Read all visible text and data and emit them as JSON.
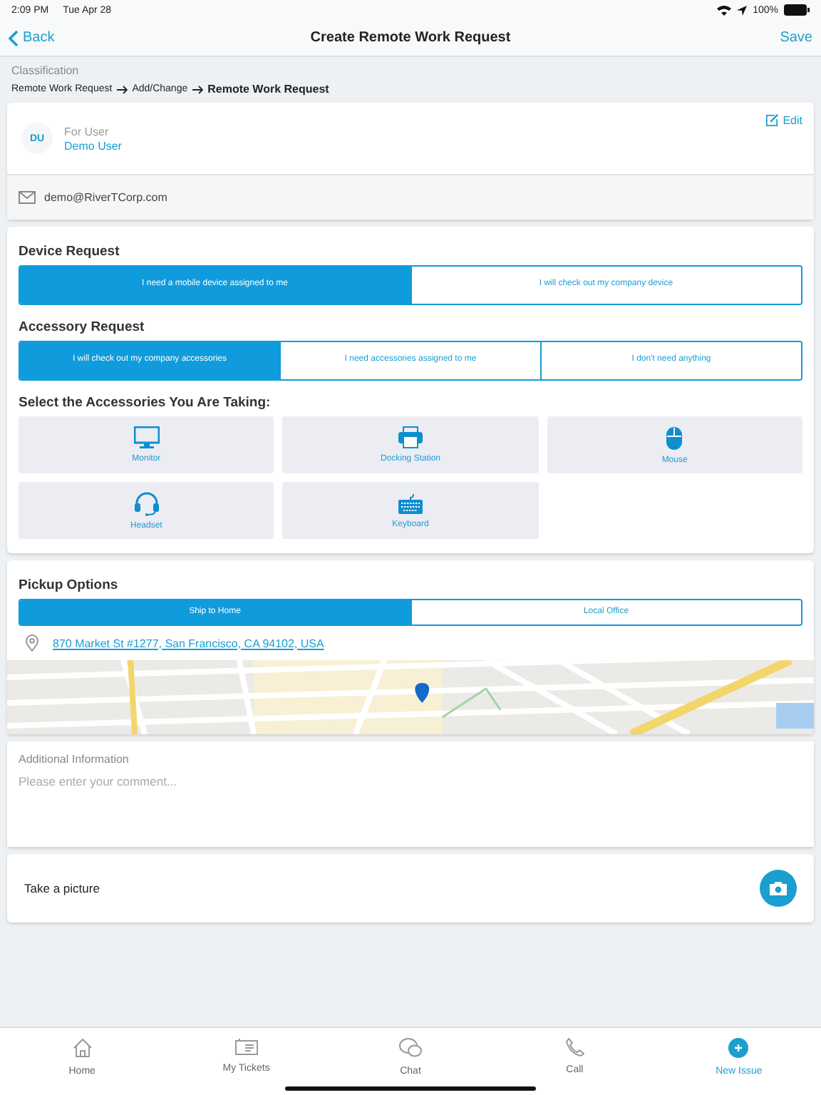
{
  "status_bar": {
    "time": "2:09 PM",
    "date": "Tue Apr 28",
    "battery": "100%"
  },
  "nav": {
    "back": "Back",
    "title": "Create Remote Work Request",
    "save": "Save"
  },
  "classification": {
    "label": "Classification",
    "path": [
      "Remote Work Request",
      "Add/Change"
    ],
    "current": "Remote Work Request"
  },
  "user": {
    "initials": "DU",
    "label": "For User",
    "name": "Demo User",
    "edit": "Edit",
    "email": "demo@RiverTCorp.com"
  },
  "device_request": {
    "title": "Device Request",
    "options": [
      {
        "label": "I need a mobile device assigned to me",
        "selected": true
      },
      {
        "label": "I will check out my company device",
        "selected": false
      }
    ]
  },
  "accessory_request": {
    "title": "Accessory Request",
    "options": [
      {
        "label": "I will check out my company accessories",
        "selected": true
      },
      {
        "label": "I need accessories assigned to me",
        "selected": false
      },
      {
        "label": "I don't need anything",
        "selected": false
      }
    ]
  },
  "accessories": {
    "title": "Select the Accessories You Are Taking:",
    "items": [
      {
        "kind": "monitor",
        "label": "Monitor"
      },
      {
        "kind": "dock",
        "label": "Docking Station"
      },
      {
        "kind": "mouse",
        "label": "Mouse"
      },
      {
        "kind": "headset",
        "label": "Headset"
      },
      {
        "kind": "keyboard",
        "label": "Keyboard"
      }
    ]
  },
  "pickup": {
    "title": "Pickup Options",
    "options": [
      {
        "label": "Ship to Home",
        "selected": true
      },
      {
        "label": "Local Office",
        "selected": false
      }
    ],
    "address": "870 Market St #1277, San Francisco, CA 94102, USA"
  },
  "additional_info": {
    "label": "Additional Information",
    "placeholder": "Please enter your comment..."
  },
  "picture": {
    "label": "Take a picture"
  },
  "tab_bar": [
    {
      "kind": "home",
      "label": "Home",
      "selected": false
    },
    {
      "kind": "tickets",
      "label": "My Tickets",
      "selected": false
    },
    {
      "kind": "chat",
      "label": "Chat",
      "selected": false
    },
    {
      "kind": "call",
      "label": "Call",
      "selected": false
    },
    {
      "kind": "new",
      "label": "New Issue",
      "selected": true
    }
  ]
}
